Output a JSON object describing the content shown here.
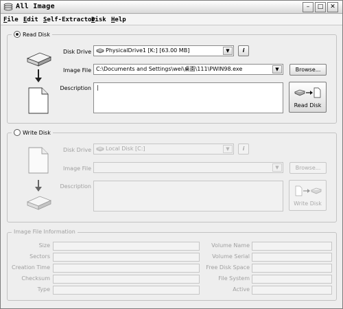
{
  "window": {
    "title": "All Image",
    "controls": {
      "minimize": "–",
      "maximize": "□",
      "close": "✕"
    }
  },
  "menu": [
    {
      "mnemonic": "F",
      "rest": "ile"
    },
    {
      "mnemonic": "E",
      "rest": "dit"
    },
    {
      "mnemonic": "S",
      "rest": "elf-Extractor"
    },
    {
      "mnemonic": "D",
      "rest": "isk"
    },
    {
      "mnemonic": "H",
      "rest": "elp"
    }
  ],
  "read_disk": {
    "legend": "Read Disk",
    "selected": true,
    "disk_drive_label": "Disk Drive",
    "disk_drive_value": "PhysicalDrive1 [K:] [63.00 MB]",
    "info_button": "i",
    "image_file_label": "Image File",
    "image_file_value": "C:\\Documents and Settings\\wei\\桌面\\111\\PWIN98.exe",
    "browse_button": "Browse...",
    "description_label": "Description",
    "description_value": "|",
    "action_button": "Read Disk"
  },
  "write_disk": {
    "legend": "Write Disk",
    "selected": false,
    "disk_drive_label": "Disk Drive",
    "disk_drive_value": "Local Disk [C:]",
    "info_button": "i",
    "image_file_label": "Image File",
    "image_file_value": "",
    "browse_button": "Browse...",
    "description_label": "Description",
    "action_button": "Write Disk"
  },
  "image_info": {
    "legend": "Image File Information",
    "left_labels": [
      "Size",
      "Sectors",
      "Creation Time",
      "Checksum",
      "Type"
    ],
    "right_labels": [
      "Volume Name",
      "Volume Serial",
      "Free Disk Space",
      "File System",
      "Active"
    ]
  }
}
